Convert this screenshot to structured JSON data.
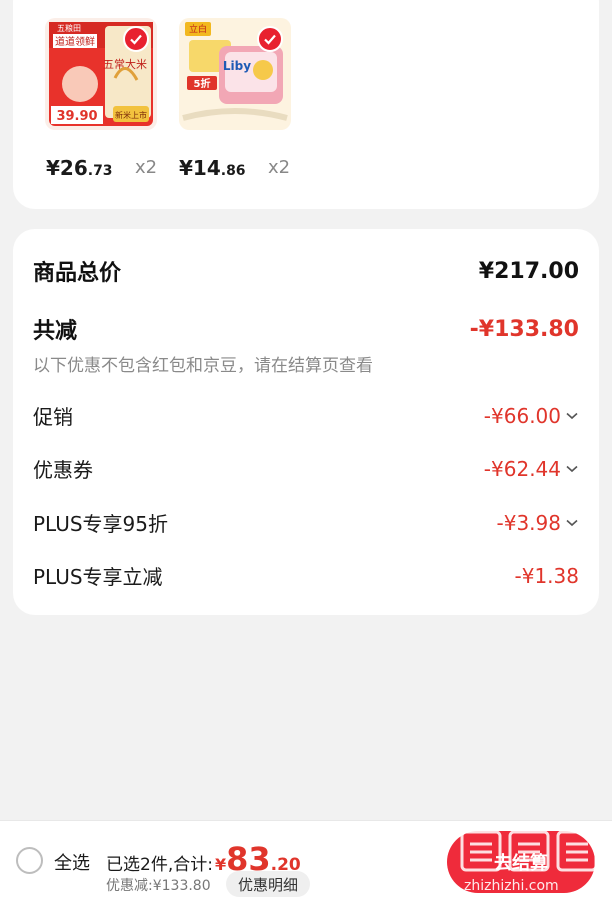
{
  "products": [
    {
      "name_icon": "rice-product-image",
      "price_int": "¥26",
      "price_dec": ".73",
      "qty": "x2",
      "image_text": {
        "brand": "五粮田",
        "banner": "道道领鲜",
        "main": "五常大米",
        "price": "39.90",
        "tag": "新米上市"
      }
    },
    {
      "name_icon": "liby-product-image",
      "price_int": "¥14",
      "price_dec": ".86",
      "qty": "x2",
      "image_text": {
        "brand": "立白",
        "logo": "Liby",
        "tag": "5折"
      }
    }
  ],
  "summary": {
    "total_label": "商品总价",
    "total_value": "¥217.00",
    "reduce_label": "共减",
    "reduce_value": "-¥133.80",
    "note": "以下优惠不包含红包和京豆，请在结算页查看",
    "details": [
      {
        "label": "促销",
        "value": "-¥66.00",
        "has_chevron": true
      },
      {
        "label": "优惠券",
        "value": "-¥62.44",
        "has_chevron": true
      },
      {
        "label": "PLUS专享95折",
        "value": "-¥3.98",
        "has_chevron": true
      },
      {
        "label": "PLUS专享立减",
        "value": "-¥1.38",
        "has_chevron": false
      }
    ]
  },
  "bottom_bar": {
    "select_all": "全选",
    "selected_text": "已选2件,合计:",
    "total_currency": "¥",
    "total_int": "83",
    "total_dec": ".20",
    "discount_text": "优惠减:¥133.80",
    "detail_button": "优惠明细",
    "checkout_button": "去结算"
  },
  "watermark": "zhizhizhi.com",
  "colors": {
    "accent_red": "#e0352b",
    "button_red": "#ef2b3b"
  }
}
